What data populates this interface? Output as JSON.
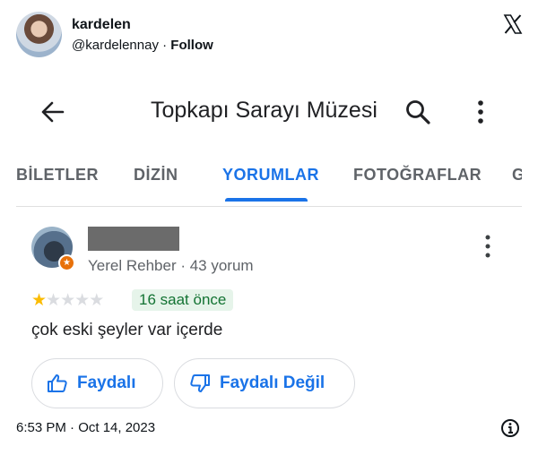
{
  "tweet": {
    "author_name": "kardelen",
    "handle": "@kardelennay",
    "separator": " · ",
    "follow_label": "Follow",
    "timestamp": "6:53 PM · Oct 14, 2023"
  },
  "maps_screenshot": {
    "title": "Topkapı Sarayı Müzesi",
    "tabs": [
      {
        "label": "BİLETLER",
        "active": false
      },
      {
        "label": "DİZİN",
        "active": false
      },
      {
        "label": "YORUMLAR",
        "active": true
      },
      {
        "label": "FOTOĞRAFLAR",
        "active": false
      },
      {
        "label": "G",
        "active": false
      }
    ],
    "review": {
      "reviewer_meta": "Yerel Rehber · 43 yorum",
      "rating": 1,
      "rating_max": 5,
      "time_ago": "16 saat önce",
      "text": "çok eski şeyler var içerde",
      "helpful_label": "Faydalı",
      "not_helpful_label": "Faydalı Değil"
    }
  },
  "colors": {
    "accent": "#1a73e8",
    "star_on": "#fbbc04",
    "badge_bg": "#e6f4ea",
    "badge_text": "#137333"
  }
}
